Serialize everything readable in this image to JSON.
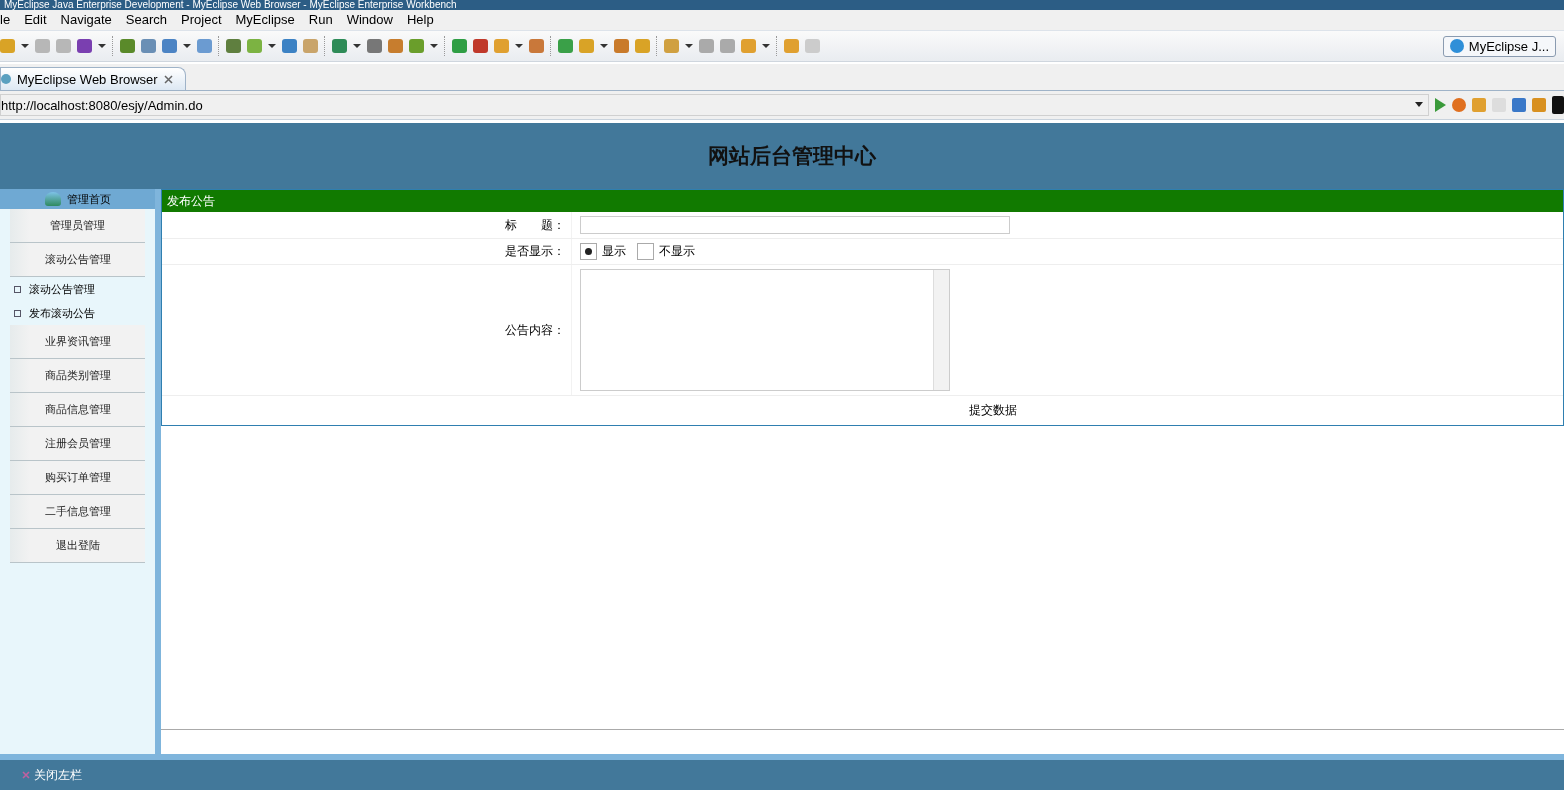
{
  "window": {
    "title": "MyEclipse Java Enterprise Development - MyEclipse Web Browser - MyEclipse Enterprise Workbench"
  },
  "menu": [
    "le",
    "Edit",
    "Navigate",
    "Search",
    "Project",
    "MyEclipse",
    "Run",
    "Window",
    "Help"
  ],
  "perspective": {
    "label": "MyEclipse J..."
  },
  "editor_tab": {
    "label": "MyEclipse Web Browser"
  },
  "address_bar": {
    "value": "http://localhost:8080/esjy/Admin.do"
  },
  "page": {
    "heading": "网站后台管理中心",
    "sidebar": {
      "home": "管理首页",
      "items": [
        {
          "kind": "button",
          "label": "管理员管理"
        },
        {
          "kind": "button",
          "label": "滚动公告管理"
        },
        {
          "kind": "link",
          "label": "滚动公告管理"
        },
        {
          "kind": "link",
          "label": "发布滚动公告"
        },
        {
          "kind": "button",
          "label": "业界资讯管理"
        },
        {
          "kind": "button",
          "label": "商品类别管理"
        },
        {
          "kind": "button",
          "label": "商品信息管理"
        },
        {
          "kind": "button",
          "label": "注册会员管理"
        },
        {
          "kind": "button",
          "label": "购买订单管理"
        },
        {
          "kind": "button",
          "label": "二手信息管理"
        },
        {
          "kind": "button",
          "label": "退出登陆"
        }
      ]
    },
    "panel": {
      "title": "发布公告",
      "fields": [
        {
          "kind": "text",
          "label": "标　　题："
        },
        {
          "kind": "radio",
          "label": "是否显示：",
          "options": [
            {
              "label": "显示",
              "selected": true
            },
            {
              "label": "不显示",
              "selected": false
            }
          ]
        },
        {
          "kind": "textarea",
          "label": "公告内容："
        }
      ],
      "submit": "提交数据"
    },
    "footer": "关闭左栏"
  }
}
